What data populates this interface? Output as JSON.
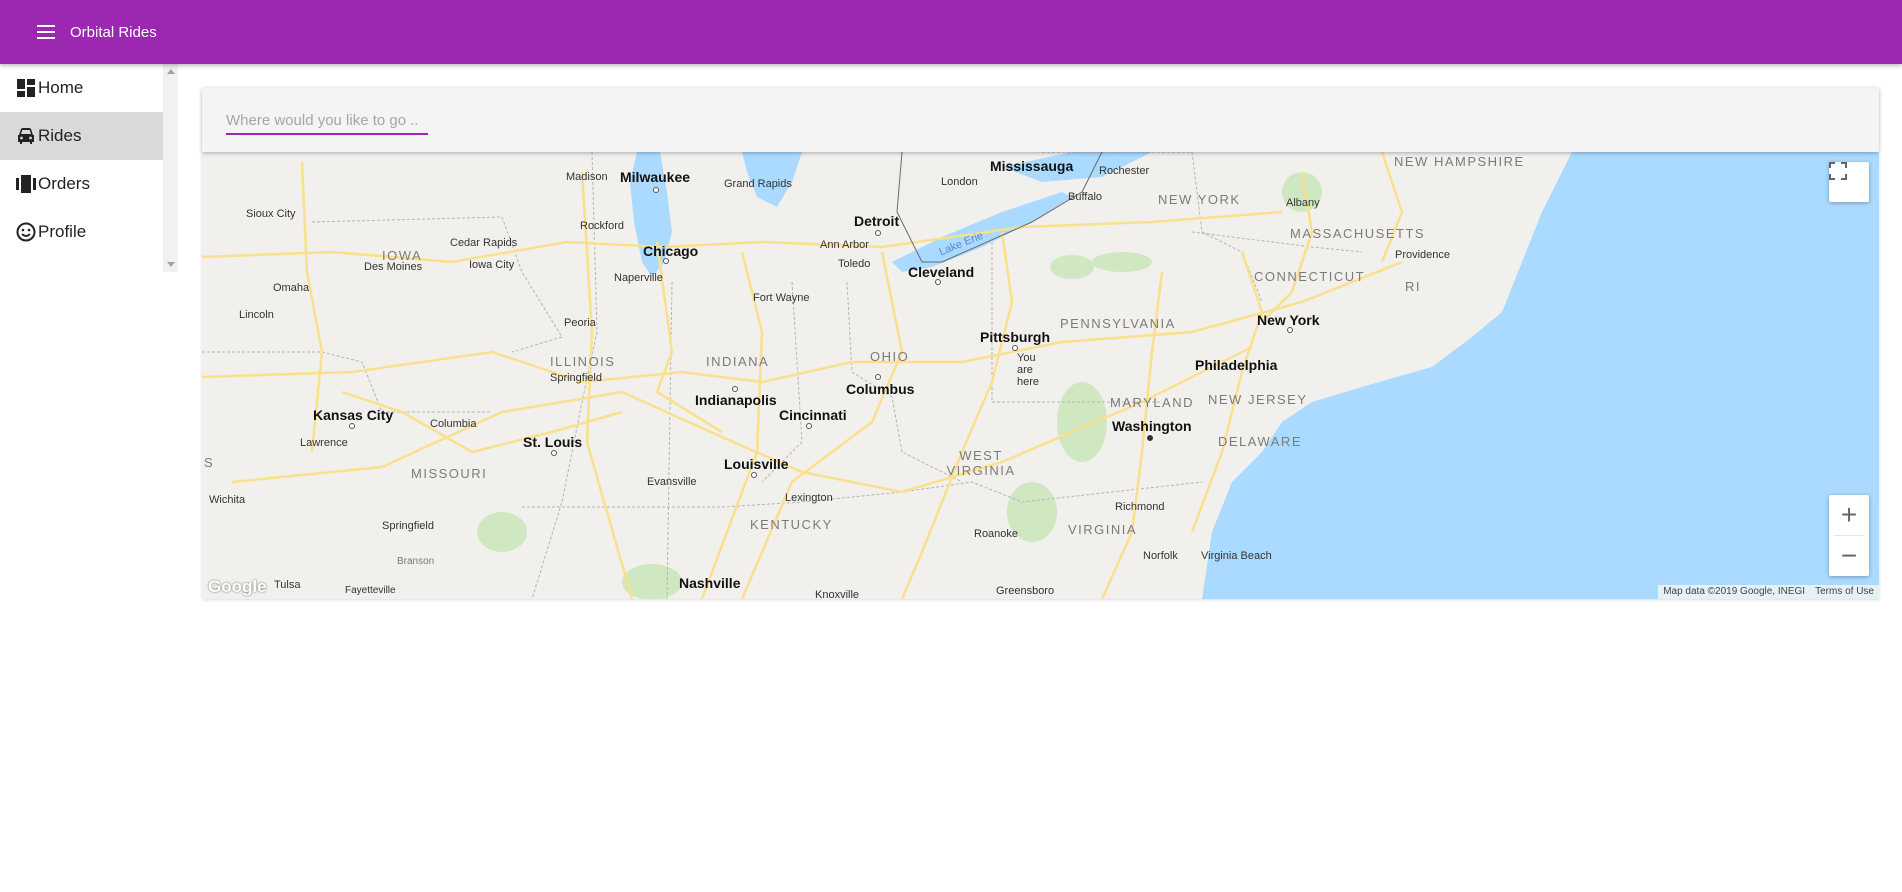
{
  "appbar": {
    "title": "Orbital Rides",
    "menu_icon": "hamburger-icon",
    "color": "#9c27b0"
  },
  "sidebar": {
    "items": [
      {
        "label": "Home",
        "icon": "dashboard-icon",
        "selected": false
      },
      {
        "label": "Rides",
        "icon": "car-icon",
        "selected": true
      },
      {
        "label": "Orders",
        "icon": "carousel-icon",
        "selected": false
      },
      {
        "label": "Profile",
        "icon": "smiley-icon",
        "selected": false
      }
    ]
  },
  "search": {
    "placeholder": "Where would you like to go ..",
    "value": ""
  },
  "map": {
    "cities": [
      "Milwaukee",
      "Madison",
      "Grand Rapids",
      "Mississauga",
      "Rochester",
      "London",
      "Buffalo",
      "Albany",
      "Detroit",
      "Ann Arbor",
      "Toledo",
      "Chicago",
      "Naperville",
      "Rockford",
      "Cedar Rapids",
      "Iowa City",
      "Des Moines",
      "Sioux City",
      "Omaha",
      "Lincoln",
      "Cleveland",
      "Fort Wayne",
      "Peoria",
      "Pittsburgh",
      "Providence",
      "New York",
      "Springfield",
      "Indianapolis",
      "Columbus",
      "Philadelphia",
      "Cincinnati",
      "Kansas City",
      "Columbia",
      "Lawrence",
      "Washington",
      "St. Louis",
      "Louisville",
      "Evansville",
      "Lexington",
      "Wichita",
      "Richmond",
      "Springfield",
      "Roanoke",
      "Norfolk",
      "Virginia Beach",
      "Branson",
      "Tulsa",
      "Fayetteville",
      "Nashville",
      "Knoxville",
      "Greensboro"
    ],
    "states": [
      "NEW HAMPSHIRE",
      "NEW YORK",
      "MASSACHUSETTS",
      "IOWA",
      "CONNECTICUT",
      "RI",
      "PENNSYLVANIA",
      "ILLINOIS",
      "INDIANA",
      "OHIO",
      "MARYLAND",
      "NEW JERSEY",
      "DELAWARE",
      "MISSOURI",
      "WEST VIRGINIA",
      "KENTUCKY",
      "VIRGINIA",
      "S"
    ],
    "lake_label": "Lake Erie",
    "you_are_here": "You are here",
    "google": "Google",
    "map_data": "Map data ©2019 Google, INEGI",
    "terms": "Terms of Use",
    "zoom_in": "+",
    "zoom_out": "−",
    "water_color": "#aadaff",
    "road_color": "#fbe08c"
  }
}
